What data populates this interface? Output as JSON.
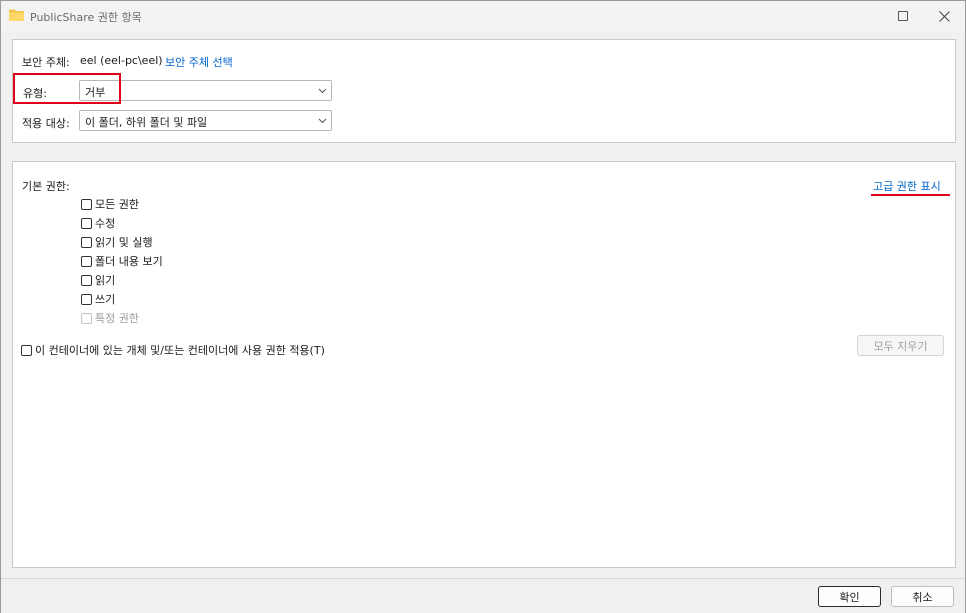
{
  "window": {
    "title": "PublicShare 권한 항목"
  },
  "top_panel": {
    "principal_label": "보안 주체:",
    "principal_value": "eel (eel-pc\\eel)",
    "select_principal_link": "보안 주체 선택",
    "type_label": "유형:",
    "type_value": "거부",
    "applies_label": "적용 대상:",
    "applies_value": "이 폴더, 하위 폴더 및 파일"
  },
  "permissions": {
    "heading": "기본 권한:",
    "advanced_link": "고급 권한 표시",
    "items": [
      {
        "label": "모든 권한",
        "checked": false,
        "enabled": true
      },
      {
        "label": "수정",
        "checked": false,
        "enabled": true
      },
      {
        "label": "읽기 및 실행",
        "checked": false,
        "enabled": true
      },
      {
        "label": "폴더 내용 보기",
        "checked": false,
        "enabled": true
      },
      {
        "label": "읽기",
        "checked": false,
        "enabled": true
      },
      {
        "label": "쓰기",
        "checked": false,
        "enabled": true
      },
      {
        "label": "특정 권한",
        "checked": false,
        "enabled": false
      }
    ],
    "apply_container_label": "이 컨테이너에 있는 개체 및/또는 컨테이너에 사용 권한 적용(T)",
    "clear_all_label": "모두 지우기"
  },
  "footer": {
    "ok_label": "확인",
    "cancel_label": "취소"
  },
  "icons": {
    "folder": "folder-icon",
    "maximize": "maximize-icon",
    "close": "close-icon",
    "dropdown": "chevron-down-icon"
  },
  "colors": {
    "link": "#0066cc",
    "annotation": "#e0001b"
  }
}
